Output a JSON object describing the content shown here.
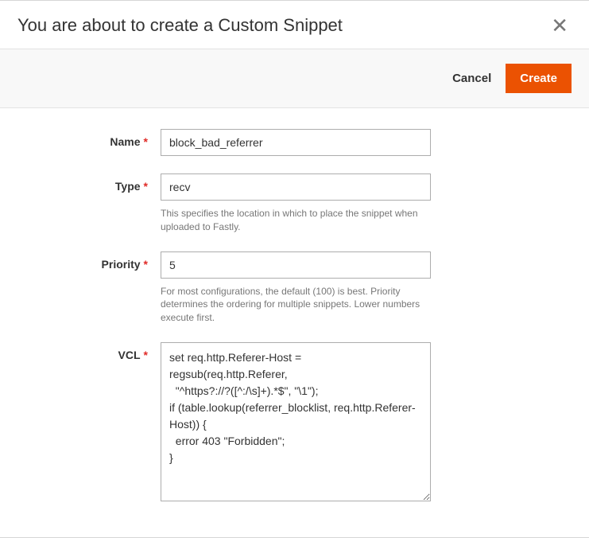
{
  "header": {
    "title": "You are about to create a Custom Snippet"
  },
  "actions": {
    "cancel": "Cancel",
    "create": "Create"
  },
  "form": {
    "name": {
      "label": "Name",
      "value": "block_bad_referrer"
    },
    "type": {
      "label": "Type",
      "value": "recv",
      "help": "This specifies the location in which to place the snippet when uploaded to Fastly."
    },
    "priority": {
      "label": "Priority",
      "value": "5",
      "help": "For most configurations, the default (100) is best. Priority determines the ordering for multiple snippets. Lower numbers execute first."
    },
    "vcl": {
      "label": "VCL",
      "value": "set req.http.Referer-Host = regsub(req.http.Referer,\n  \"^https?://?([^:/\\s]+).*$\", \"\\1\");\nif (table.lookup(referrer_blocklist, req.http.Referer-Host)) {\n  error 403 \"Forbidden\";\n}"
    }
  }
}
